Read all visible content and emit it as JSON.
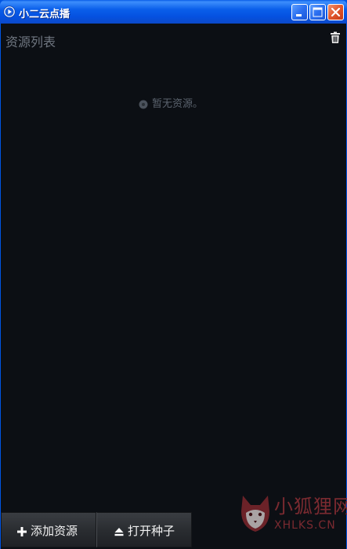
{
  "window": {
    "title": "小二云点播",
    "controls": {
      "minimize_icon": "minimize-icon",
      "maximize_icon": "maximize-icon",
      "close_icon": "close-icon"
    }
  },
  "panel": {
    "title": "资源列表",
    "delete_icon": "trash-icon",
    "empty_message": "暂无资源。"
  },
  "actions": {
    "add_label": "添加资源",
    "add_icon": "plus-icon",
    "open_label": "打开种子",
    "open_icon": "eject-icon"
  },
  "watermark": {
    "text_cn": "小狐狸网",
    "text_en": "XHLKS.CN"
  },
  "colors": {
    "titlebar": "#0a5fea",
    "client_bg": "#0c0f14",
    "muted_text": "#6f7680",
    "button_bg": "#2a2d31",
    "close_button": "#e1562c",
    "watermark": "#7a2a30"
  }
}
